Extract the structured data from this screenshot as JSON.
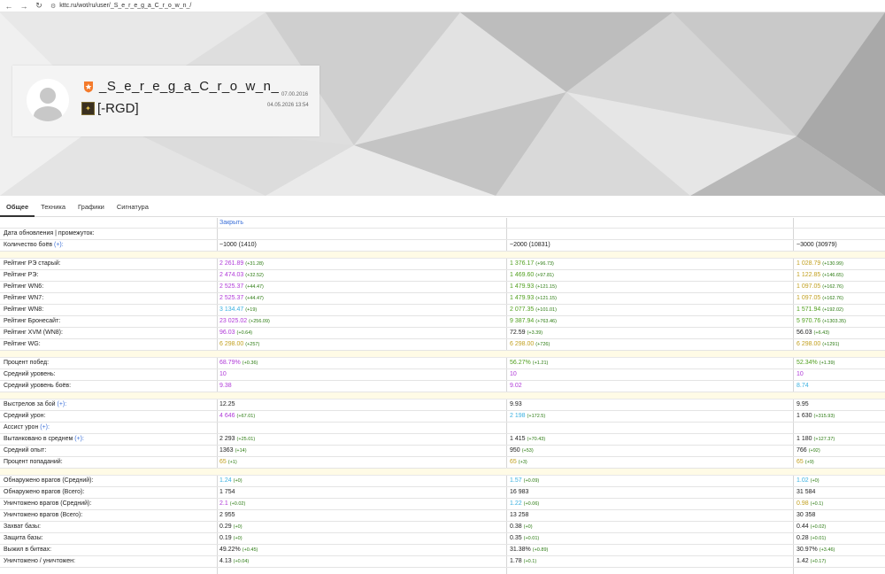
{
  "browser": {
    "url": "kttc.ru/wot/ru/user/_S_e_r_e_g_a_C_r_o_w_n_/",
    "back_icon": "←",
    "forward_icon": "→",
    "reload_icon": "↻",
    "site_icon": "⚙"
  },
  "profile": {
    "username": "_S_e_r_e_g_a_C_r_o_w_n_",
    "clan": "[-RGD]",
    "date_registered": "07.00.2016",
    "date_updated": "04.05.2026 13:54",
    "colors": {
      "badge": "#f47a2b"
    }
  },
  "tabs": [
    {
      "label": "Общее",
      "active": true
    },
    {
      "label": "Техника",
      "active": false
    },
    {
      "label": "Графики",
      "active": false
    },
    {
      "label": "Сигнатура",
      "active": false
    }
  ],
  "stats": {
    "close_label": "Закрыть",
    "colors": {
      "purple": "#b03ad8",
      "green": "#52a020",
      "yellow": "#c2a020",
      "blue": "#3ab0e0",
      "black": "#222222",
      "delta": "#2a7a10"
    },
    "rows": [
      {
        "label": "Дата обновления | промежуток:",
        "cells": []
      },
      {
        "label": "Количество боёв",
        "plus": "(+):",
        "cells": [
          {
            "v": "~1000 (1410)",
            "c": "black"
          },
          {
            "v": "~2000 (10831)",
            "c": "black"
          },
          {
            "v": "~3000 (30979)",
            "c": "black"
          }
        ]
      },
      {
        "sep": true
      },
      {
        "label": "Рейтинг РЭ старый:",
        "cells": [
          {
            "v": "2 261.89",
            "d": "(+31.28)",
            "c": "purple"
          },
          {
            "v": "1 376.17",
            "d": "(+96.73)",
            "c": "green"
          },
          {
            "v": "1 028.79",
            "d": "(+130.99)",
            "c": "yellow"
          }
        ]
      },
      {
        "label": "Рейтинг РЭ:",
        "cells": [
          {
            "v": "2 474.03",
            "d": "(+32.52)",
            "c": "purple"
          },
          {
            "v": "1 469.60",
            "d": "(+97.81)",
            "c": "green"
          },
          {
            "v": "1 122.85",
            "d": "(+146.65)",
            "c": "yellow"
          }
        ]
      },
      {
        "label": "Рейтинг WN6:",
        "cells": [
          {
            "v": "2 525.37",
            "d": "(+44.47)",
            "c": "purple"
          },
          {
            "v": "1 479.93",
            "d": "(+121.15)",
            "c": "green"
          },
          {
            "v": "1 097.05",
            "d": "(+162.76)",
            "c": "yellow"
          }
        ]
      },
      {
        "label": "Рейтинг WN7:",
        "cells": [
          {
            "v": "2 525.37",
            "d": "(+44.47)",
            "c": "purple"
          },
          {
            "v": "1 479.93",
            "d": "(+121.15)",
            "c": "green"
          },
          {
            "v": "1 097.05",
            "d": "(+162.76)",
            "c": "yellow"
          }
        ]
      },
      {
        "label": "Рейтинг WN8:",
        "cells": [
          {
            "v": "3 134.47",
            "d": "(+19)",
            "c": "blue"
          },
          {
            "v": "2 077.35",
            "d": "(+101.01)",
            "c": "green"
          },
          {
            "v": "1 571.94",
            "d": "(+192.02)",
            "c": "green"
          }
        ]
      },
      {
        "label": "Рейтинг Бронесайт:",
        "cells": [
          {
            "v": "23 025.02",
            "d": "(+256.09)",
            "c": "purple"
          },
          {
            "v": "9 387.94",
            "d": "(+763.46)",
            "c": "green"
          },
          {
            "v": "5 970.76",
            "d": "(+1303.35)",
            "c": "green"
          }
        ]
      },
      {
        "label": "Рейтинг XVM (WN8):",
        "cells": [
          {
            "v": "96.03",
            "d": "(+0.64)",
            "c": "purple"
          },
          {
            "v": "72.59",
            "d": "(+3.39)",
            "c": "black"
          },
          {
            "v": "56.03",
            "d": "(+6.43)",
            "c": "black"
          }
        ]
      },
      {
        "label": "Рейтинг WG:",
        "cells": [
          {
            "v": "6 298.00",
            "d": "(+257)",
            "c": "yellow"
          },
          {
            "v": "6 298.00",
            "d": "(+726)",
            "c": "yellow"
          },
          {
            "v": "6 298.00",
            "d": "(+1291)",
            "c": "yellow"
          }
        ]
      },
      {
        "sep": true
      },
      {
        "label": "Процент побед:",
        "cells": [
          {
            "v": "68.79%",
            "d": "(+0.36)",
            "c": "purple"
          },
          {
            "v": "56.27%",
            "d": "(+1.21)",
            "c": "green"
          },
          {
            "v": "52.34%",
            "d": "(+1.39)",
            "c": "green"
          }
        ]
      },
      {
        "label": "Средний уровень:",
        "cells": [
          {
            "v": "10",
            "c": "purple"
          },
          {
            "v": "10",
            "c": "purple"
          },
          {
            "v": "10",
            "c": "purple"
          }
        ]
      },
      {
        "label": "Средний уровень боёв:",
        "cells": [
          {
            "v": "9.38",
            "c": "purple"
          },
          {
            "v": "9.02",
            "c": "purple"
          },
          {
            "v": "8.74",
            "c": "blue"
          }
        ]
      },
      {
        "sep": true
      },
      {
        "label": "Выстрелов за бой",
        "plus": "(+):",
        "cells": [
          {
            "v": "12.25",
            "c": "black"
          },
          {
            "v": "9.93",
            "c": "black"
          },
          {
            "v": "9.95",
            "c": "black"
          }
        ]
      },
      {
        "label": "Средний урон:",
        "cells": [
          {
            "v": "4 646",
            "d": "(+67.01)",
            "c": "purple"
          },
          {
            "v": "2 198",
            "d": "(+172.5)",
            "c": "blue"
          },
          {
            "v": "1 630",
            "d": "(+315.93)",
            "c": "black"
          }
        ]
      },
      {
        "label": "Ассист урон",
        "plus": "(+):",
        "cells": []
      },
      {
        "label": "Вытанковано в среднем",
        "plus": "(+):",
        "cells": [
          {
            "v": "2 293",
            "d": "(+25.01)",
            "c": "black"
          },
          {
            "v": "1 415",
            "d": "(+70.43)",
            "c": "black"
          },
          {
            "v": "1 180",
            "d": "(+127.37)",
            "c": "black"
          }
        ]
      },
      {
        "label": "Средний опыт:",
        "cells": [
          {
            "v": "1363",
            "d": "(+14)",
            "c": "black"
          },
          {
            "v": "950",
            "d": "(+53)",
            "c": "black"
          },
          {
            "v": "766",
            "d": "(+92)",
            "c": "black"
          }
        ]
      },
      {
        "label": "Процент попаданий:",
        "cells": [
          {
            "v": "65",
            "d": "(+1)",
            "c": "yellow"
          },
          {
            "v": "65",
            "d": "(+3)",
            "c": "yellow"
          },
          {
            "v": "65",
            "d": "(+9)",
            "c": "yellow"
          }
        ]
      },
      {
        "sep": true
      },
      {
        "label": "Обнаружено врагов (Средний):",
        "cells": [
          {
            "v": "1.24",
            "d": "(+0)",
            "c": "blue"
          },
          {
            "v": "1.57",
            "d": "(+0.09)",
            "c": "blue"
          },
          {
            "v": "1.02",
            "d": "(+0)",
            "c": "blue"
          }
        ]
      },
      {
        "label": "Обнаружено врагов (Всего):",
        "cells": [
          {
            "v": "1 754",
            "c": "black"
          },
          {
            "v": "16 983",
            "c": "black"
          },
          {
            "v": "31 584",
            "c": "black"
          }
        ]
      },
      {
        "label": "Уничтожено врагов (Средний):",
        "cells": [
          {
            "v": "2.1",
            "d": "(+0.02)",
            "c": "purple"
          },
          {
            "v": "1.22",
            "d": "(+0.06)",
            "c": "blue"
          },
          {
            "v": "0.98",
            "d": "(+0.1)",
            "c": "yellow"
          }
        ]
      },
      {
        "label": "Уничтожено врагов (Всего):",
        "cells": [
          {
            "v": "2 955",
            "c": "black"
          },
          {
            "v": "13 258",
            "c": "black"
          },
          {
            "v": "30 358",
            "c": "black"
          }
        ]
      },
      {
        "label": "Захват базы:",
        "cells": [
          {
            "v": "0.29",
            "d": "(+0)",
            "c": "black"
          },
          {
            "v": "0.38",
            "d": "(+0)",
            "c": "black"
          },
          {
            "v": "0.44",
            "d": "(+0.02)",
            "c": "black"
          }
        ]
      },
      {
        "label": "Защита базы:",
        "cells": [
          {
            "v": "0.19",
            "d": "(+0)",
            "c": "black"
          },
          {
            "v": "0.35",
            "d": "(+0.01)",
            "c": "black"
          },
          {
            "v": "0.28",
            "d": "(+0.01)",
            "c": "black"
          }
        ]
      },
      {
        "label": "Выжил в битвах:",
        "cells": [
          {
            "v": "49.22%",
            "d": "(+0.45)",
            "c": "black"
          },
          {
            "v": "31.38%",
            "d": "(+0.89)",
            "c": "black"
          },
          {
            "v": "30.97%",
            "d": "(+3.46)",
            "c": "black"
          }
        ]
      },
      {
        "label": "Уничтожено / уничтожен:",
        "cells": [
          {
            "v": "4.13",
            "d": "(+0.04)",
            "c": "black"
          },
          {
            "v": "1.78",
            "d": "(+0.1)",
            "c": "black"
          },
          {
            "v": "1.42",
            "d": "(+0.17)",
            "c": "black"
          }
        ]
      }
    ]
  }
}
